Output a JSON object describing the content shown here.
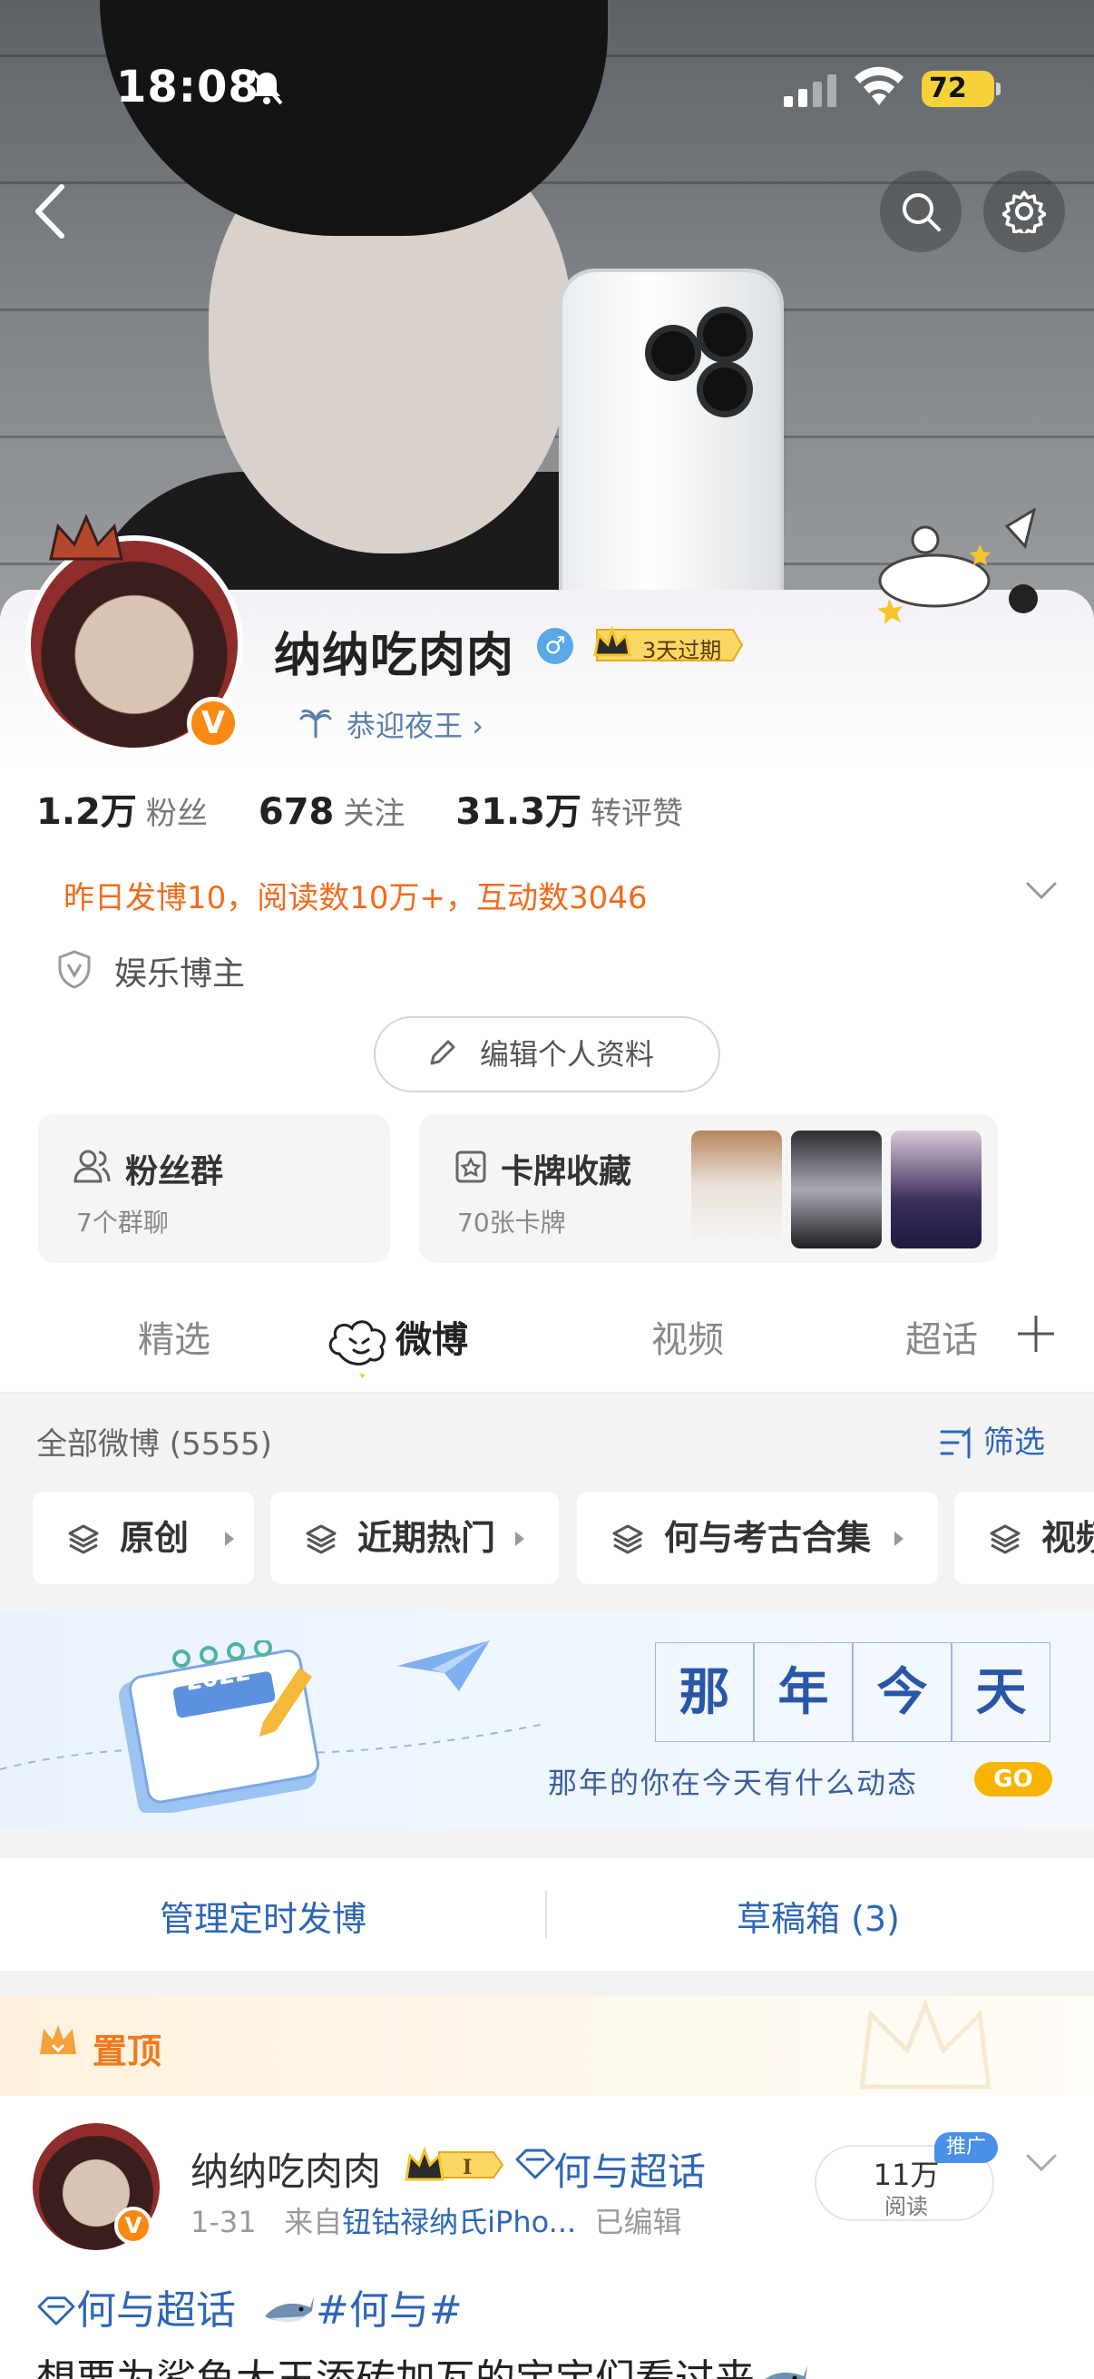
{
  "status_bar": {
    "time": "18:08",
    "battery": "72"
  },
  "profile": {
    "name": "纳纳吃肉肉",
    "vip_badge": "3天过期",
    "tagline": "恭迎夜王",
    "tagline_arrow": "›",
    "verified_badge": "V",
    "gender_icon": "male-icon"
  },
  "stats": [
    {
      "value": "1.2万",
      "label": "粉丝"
    },
    {
      "value": "678",
      "label": "关注"
    },
    {
      "value": "31.3万",
      "label": "转评赞"
    }
  ],
  "yesterday_summary": "昨日发博10，阅读数10万+，互动数3046",
  "role": "娱乐博主",
  "edit_profile_label": "编辑个人资料",
  "fan_group": {
    "title": "粉丝群",
    "subtitle": "7个群聊"
  },
  "card_collection": {
    "title": "卡牌收藏",
    "subtitle": "70张卡牌"
  },
  "tabs": [
    {
      "label": "精选",
      "active": false
    },
    {
      "label": "微博",
      "active": true
    },
    {
      "label": "视频",
      "active": false
    },
    {
      "label": "超话",
      "active": false
    }
  ],
  "feed_header": {
    "all_posts": "全部微博 (5555)",
    "filter_label": "筛选"
  },
  "chips": [
    {
      "label": "原创"
    },
    {
      "label": "近期热门"
    },
    {
      "label": "何与考古合集"
    },
    {
      "label": "视频"
    }
  ],
  "banner": {
    "title_chars": [
      "那",
      "年",
      "今",
      "天"
    ],
    "subtitle": "那年的你在今天有什么动态",
    "go_label": "GO",
    "calendar_year": "2022"
  },
  "manage_scheduled": "管理定时发博",
  "drafts": "草稿箱 (3)",
  "pinned": {
    "label": "置顶",
    "author": "纳纳吃肉肉",
    "super_topic": "何与超话",
    "date": "1-31",
    "source_prefix": "来自",
    "source": "钮钴禄纳氏iPho...",
    "edited": "已编辑",
    "reads_value": "11万",
    "reads_label": "阅读",
    "promo_label": "推广",
    "text_line1_topic": "何与超话",
    "text_line1_hashtag": "#何与#",
    "text_line2": "想要为鲨鱼大王添砖加瓦的宝宝们看过来"
  },
  "colors": {
    "accent_blue": "#2d66b6",
    "orange": "#f26b1d",
    "gold": "#f8b400",
    "verified_orange": "#f88a13"
  }
}
